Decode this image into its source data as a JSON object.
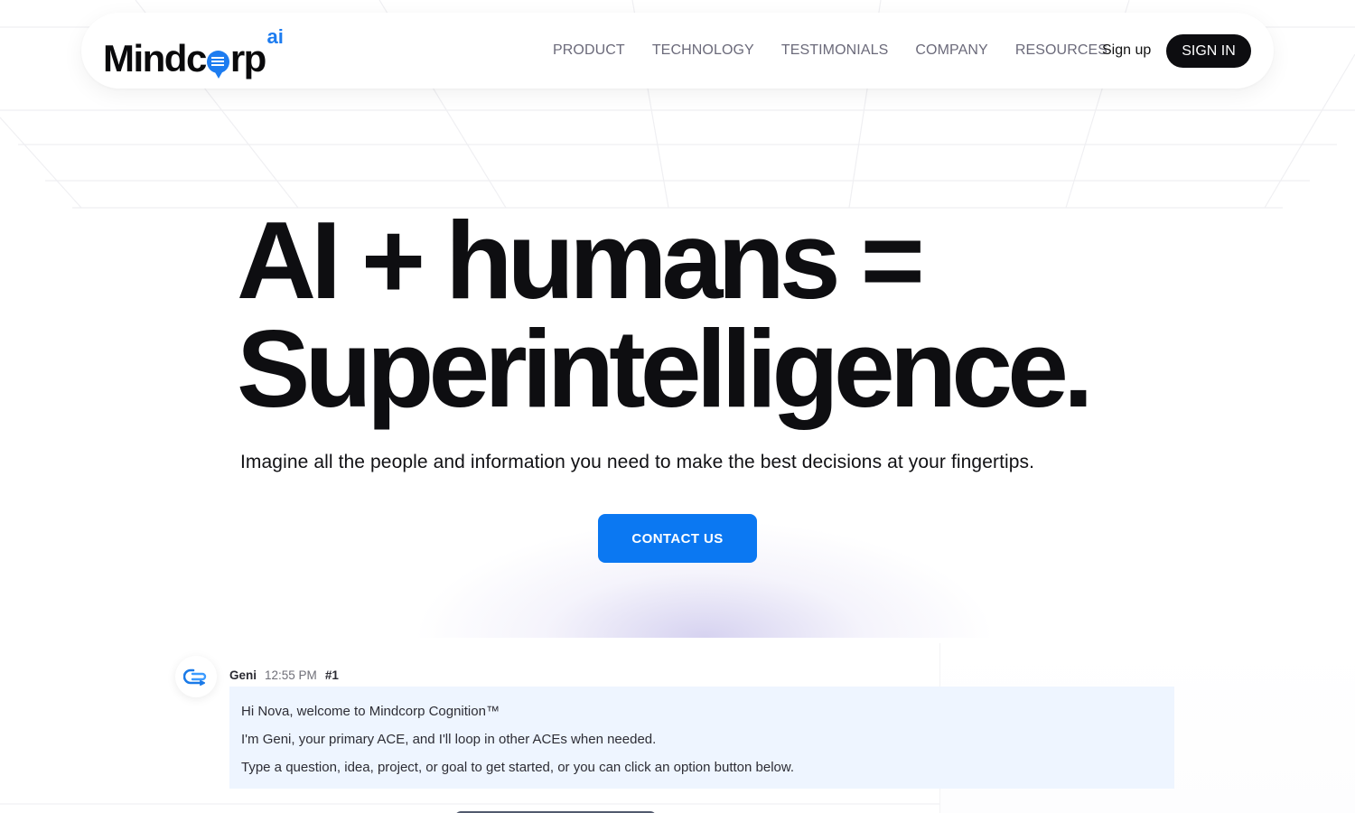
{
  "brand": {
    "logo_text_start": "Mindc",
    "logo_text_end": "rp",
    "logo_superscript": "ai",
    "accent_color": "#1d7cf0"
  },
  "nav": {
    "links": [
      "PRODUCT",
      "TECHNOLOGY",
      "TESTIMONIALS",
      "COMPANY",
      "RESOURCES"
    ],
    "signup_label": "Sign up",
    "signin_label": "SIGN IN"
  },
  "hero": {
    "title_line1": "AI + humans =",
    "title_line2": "Superintelligence.",
    "subtitle": "Imagine all the people and information you need to make the best decisions at your fingertips.",
    "cta_label": "CONTACT US",
    "cta_color": "#0b78f2"
  },
  "chat": {
    "sender": "Geni",
    "time": "12:55 PM",
    "message_number": "#1",
    "avatar_icon": "mindcorp-loop-icon",
    "lines": [
      "Hi Nova, welcome to Mindcorp Cognition™",
      "I'm Geni, your primary ACE, and I'll loop in other ACEs when needed.",
      "Type a question, idea, project, or goal to get started, or you can click an option button below."
    ]
  }
}
